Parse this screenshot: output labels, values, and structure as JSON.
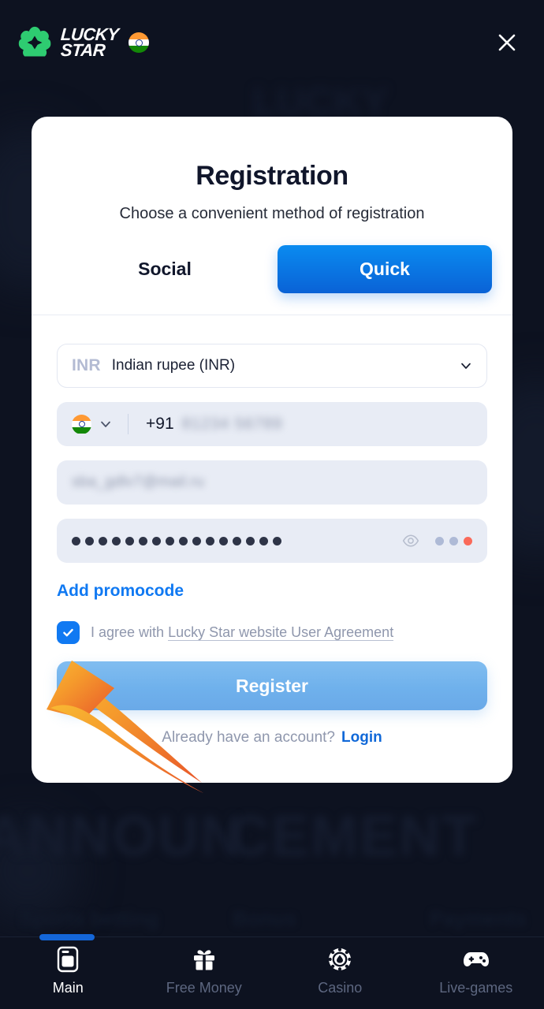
{
  "header": {
    "brand_line1": "LUCKY",
    "brand_line2": "STAR",
    "flag_icon": "india-flag-icon",
    "clover_icon": "clover-logo-icon",
    "close_icon": "close-icon"
  },
  "modal": {
    "title": "Registration",
    "subtitle": "Choose a convenient method of registration",
    "tabs": [
      {
        "label": "Social",
        "active": false
      },
      {
        "label": "Quick",
        "active": true
      }
    ],
    "currency": {
      "code": "INR",
      "name": "Indian rupee (INR)",
      "chevron_icon": "chevron-down-icon"
    },
    "phone": {
      "flag_icon": "india-flag-icon",
      "chevron_icon": "chevron-down-icon",
      "dial_code": "+91",
      "value_masked": "81234 56789"
    },
    "email": {
      "value_masked": "sba_gdlv7@mail.ru"
    },
    "password": {
      "dots_count": 16,
      "eye_icon": "eye-icon",
      "strength_dots": [
        "#aebad6",
        "#aebad6",
        "#fa6a5a"
      ]
    },
    "promocode_label": "Add promocode",
    "agreement": {
      "checked": true,
      "check_icon": "checkmark-icon",
      "prefix": "I agree with ",
      "link": "Lucky Star website User Agreement"
    },
    "register_label": "Register",
    "login_prompt": "Already have an account?",
    "login_label": "Login"
  },
  "bottom_nav": [
    {
      "label": "Main",
      "icon": "phone-main-icon",
      "active": true
    },
    {
      "label": "Free Money",
      "icon": "gift-icon",
      "active": false
    },
    {
      "label": "Casino",
      "icon": "poker-chip-icon",
      "active": false
    },
    {
      "label": "Live-games",
      "icon": "gamepad-icon",
      "active": false
    }
  ],
  "background_ghost": {
    "g1": "ANNOUN",
    "g2": "CEMENT",
    "g3": "Sports betting",
    "g4": "Bonus",
    "g5": "Payments",
    "g6": "LUCKY"
  },
  "colors": {
    "page_bg": "#0d1220",
    "accent_blue": "#1079f2",
    "brand_green": "#2ecc71",
    "register_blue": "#6fb1ec",
    "arrow_head": "#f7b13c",
    "arrow_tail": "#e8622a"
  }
}
